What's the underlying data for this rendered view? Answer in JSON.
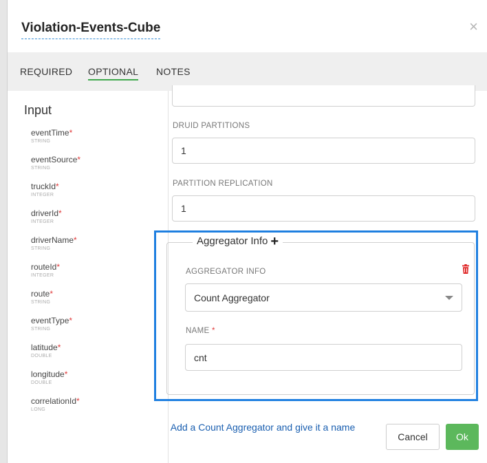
{
  "modal": {
    "title": "Violation-Events-Cube",
    "close_icon": "close-icon"
  },
  "tabs": [
    {
      "label": "REQUIRED"
    },
    {
      "label": "OPTIONAL",
      "active": true
    },
    {
      "label": "NOTES"
    }
  ],
  "input": {
    "title": "Input",
    "fields": [
      {
        "name": "eventTime",
        "required_mark": "*",
        "type": "STRING"
      },
      {
        "name": "eventSource",
        "required_mark": "*",
        "type": "STRING"
      },
      {
        "name": "truckId",
        "required_mark": "*",
        "type": "INTEGER"
      },
      {
        "name": "driverId",
        "required_mark": "*",
        "type": "INTEGER"
      },
      {
        "name": "driverName",
        "required_mark": "*",
        "type": "STRING"
      },
      {
        "name": "routeId",
        "required_mark": "*",
        "type": "INTEGER"
      },
      {
        "name": "route",
        "required_mark": "*",
        "type": "STRING"
      },
      {
        "name": "eventType",
        "required_mark": "*",
        "type": "STRING"
      },
      {
        "name": "latitude",
        "required_mark": "*",
        "type": "DOUBLE"
      },
      {
        "name": "longitude",
        "required_mark": "*",
        "type": "DOUBLE"
      },
      {
        "name": "correlationId",
        "required_mark": "*",
        "type": "LONG"
      }
    ]
  },
  "optional": {
    "druid_partitions_label": "DRUID PARTITIONS",
    "druid_partitions_value": "1",
    "partition_replication_label": "PARTITION REPLICATION",
    "partition_replication_value": "1",
    "aggregator": {
      "legend": "Aggregator Info",
      "legend_icon": "plus-icon",
      "field_label": "AGGREGATOR INFO",
      "delete_icon": "trash-icon",
      "selected": "Count Aggregator",
      "name_label": "NAME",
      "name_required": "*",
      "name_value": "cnt"
    }
  },
  "annotation": {
    "hint": "Add a Count Aggregator and give it a name"
  },
  "footer": {
    "cancel_label": "Cancel",
    "ok_label": "Ok"
  },
  "colors": {
    "highlight_border": "#1e7fe0",
    "active_tab_underline": "#3fa84c",
    "ok_button": "#5cb85c",
    "required_mark": "#e03a3a",
    "hint_text": "#1a5fb0"
  }
}
